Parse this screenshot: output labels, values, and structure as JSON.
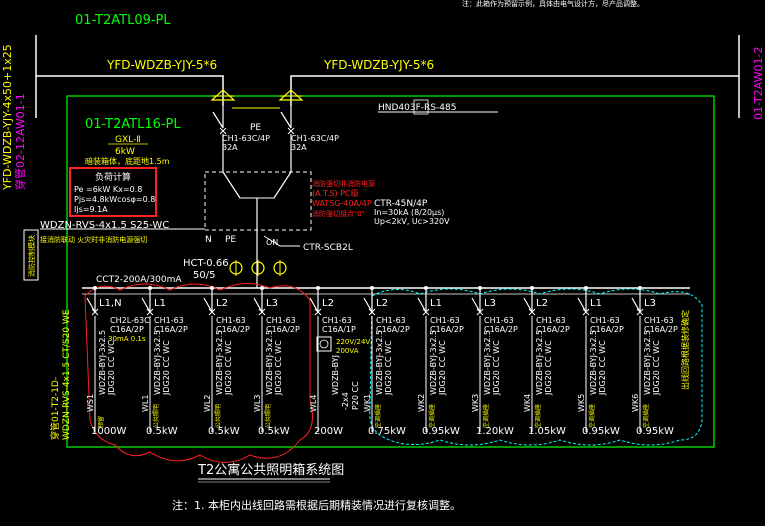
{
  "top_note": "注：此箱作为预留示例，具体由电气设计方，尽产品调整。",
  "cabinet_top_label": "01-T2ATL09-PL",
  "cabinet_left_label": "YFD-WDZB-YJY-4x50+1x25",
  "cabinet_left_sub": "穿管02-12AW01-1",
  "cabinet_right_label": "01-T2AW01-2",
  "incoming_cable_left": "YFD-WDZB-YJY-5*6",
  "incoming_cable_right": "YFD-WDZB-YJY-5*6",
  "hnd_label": "HND403F-RS-485",
  "panel": {
    "name": "01-T2ATL16-PL",
    "gxl": "GXL-Ⅱ",
    "power": "6kW",
    "sub_note": "暗装箱体，底距地1.5m"
  },
  "load_calc": {
    "title": "负荷计算",
    "line1": "Pe =6kW   Kx=0.8",
    "line2": "Pjs=4.8kWcosφ=0.8",
    "line3": "Ijs=9.1A"
  },
  "main_breakers": {
    "left": "CH1-63C/4P",
    "left_rating": "32A",
    "right": "CH1-63C/4P",
    "right_rating": "32A",
    "pe_label": "PE"
  },
  "n_label": "N",
  "pe_label2": "PE",
  "fire_note1": "消防强切非消防电源",
  "fire_note2": "(A.T.S) PC级",
  "fire_note3": "WATSG-40A/4P",
  "fire_note4": "消防强切接点\"0\"",
  "spd_label": "CTR-45N/4P",
  "spd_line2": "In=30kA (8/20μs)",
  "spd_line3": "Up<2kV, Uc>320V",
  "spd_breaker": "CTR-SCB2L",
  "on_label": "ON",
  "fire_cable": "WDZN-RVS-4x1.5 S25-WC",
  "fire_cable_note": "接消防联动 火灾时非消防电源强切",
  "fire_box_label": "消防控制模块",
  "ct_label": "HCT-0.66",
  "ct_ratio": "50/5",
  "busbar_label": "CCT2-200A/300mA",
  "rcd_label": "CH2L-63C",
  "rcd_rating": "C16A/2P",
  "rcd_ma": "30mA 0.1s",
  "left_vertical_cable": "WDZN-RVS-4x1.5 CT/S20 WE",
  "left_vertical_note": "穿管01-T2-1D-",
  "power_module": "220V/24V",
  "power_module2": "200VA",
  "power_module_cable": "WDZB-BYJ",
  "power_module_cable2": "-2x4",
  "power_module_cable3": "P20 CC",
  "right_note": "出线回路根据装修确定",
  "circuits": [
    {
      "phase": "L1,N",
      "breaker": "CH1-63",
      "rating": "C16A/2P",
      "cable": "WDZB-BYJ-3x2.5",
      "pipe": "JDG20 CC WC",
      "id": "WS1",
      "desc": "预留",
      "power": "1000W"
    },
    {
      "phase": "L1",
      "breaker": "CH1-63",
      "rating": "C16A/2P",
      "cable": "WDZB-BYJ-3x2.5",
      "pipe": "JDG20 CC WC",
      "id": "WL1",
      "desc": "公共照明",
      "power": "0.5kW"
    },
    {
      "phase": "L2",
      "breaker": "CH1-63",
      "rating": "C16A/2P",
      "cable": "WDZB-BYJ-3x2.5",
      "pipe": "JDG20 CC WC",
      "id": "WL2",
      "desc": "公共照明",
      "power": "0.5kW"
    },
    {
      "phase": "L3",
      "breaker": "CH1-63",
      "rating": "C16A/2P",
      "cable": "WDZB-BYJ-3x2.5",
      "pipe": "JDG20 CC WC",
      "id": "WL3",
      "desc": "公共照明",
      "power": "0.5kW"
    },
    {
      "phase": "L2",
      "breaker": "CH1-63",
      "rating": "C16A/1P",
      "cable": "WDZB-BYJ-3x2.5",
      "pipe": "JDG20 CC WC",
      "id": "WL4",
      "desc": "",
      "power": "200W"
    },
    {
      "phase": "L2",
      "breaker": "CH1-63",
      "rating": "C16A/2P",
      "cable": "WDZB-BYJ-3x2.5",
      "pipe": "JDG20 CC WC",
      "id": "WK1",
      "desc": "空调插座",
      "power": "0.75kW"
    },
    {
      "phase": "L1",
      "breaker": "CH1-63",
      "rating": "C16A/2P",
      "cable": "WDZB-BYJ-3x2.5",
      "pipe": "JDG20 CC WC",
      "id": "WK2",
      "desc": "空调插座",
      "power": "0.95kW"
    },
    {
      "phase": "L3",
      "breaker": "CH1-63",
      "rating": "C16A/2P",
      "cable": "WDZB-BYJ-3x2.5",
      "pipe": "JDG20 CC WC",
      "id": "WK3",
      "desc": "空调插座",
      "power": "1.20kW"
    },
    {
      "phase": "L2",
      "breaker": "CH1-63",
      "rating": "C16A/2P",
      "cable": "WDZB-BYJ-3x2.5",
      "pipe": "JDG20 CC WC",
      "id": "WK4",
      "desc": "空调插座",
      "power": "1.05kW"
    },
    {
      "phase": "L1",
      "breaker": "CH1-63",
      "rating": "C16A/2P",
      "cable": "WDZB-BYJ-3x2.5",
      "pipe": "JDG20 CC WC",
      "id": "WK5",
      "desc": "空调插座",
      "power": "0.95kW"
    },
    {
      "phase": "L3",
      "breaker": "CH1-63",
      "rating": "C16A/2P",
      "cable": "WDZB-BYJ-3x2.5",
      "pipe": "JDG20 CC WC",
      "id": "WK6",
      "desc": "空调插座",
      "power": "0.95kW"
    }
  ],
  "diagram_title": "T2公寓公共照明箱系统图",
  "footnote": "注：1. 本柜内出线回路需根据后期精装情况进行复核调整。",
  "colors": {
    "green": "#00ff00",
    "yellow": "#ffff00",
    "white": "#ffffff",
    "magenta": "#ff00ff",
    "red": "#ff2020",
    "cyan": "#00ffff"
  }
}
